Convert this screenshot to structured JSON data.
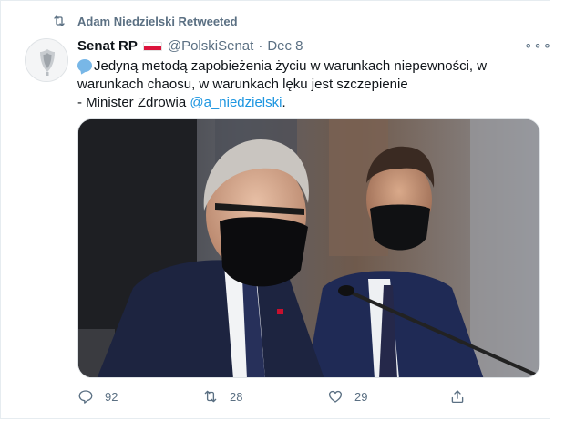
{
  "retweet": {
    "label": "Adam Niedzielski Retweeted"
  },
  "author": {
    "name": "Senat RP",
    "handle": "@PolskiSenat",
    "separator": "·",
    "date": "Dec 8"
  },
  "tweet": {
    "line1": "Jedyną metodą zapobieżenia życiu w warunkach niepewności, w",
    "line2": "warunkach chaosu, w warunkach lęku jest szczepienie",
    "line3_prefix": "- Minister Zdrowia ",
    "mention": "@a_niedzielski",
    "line3_suffix": "."
  },
  "more_label": "∘∘∘",
  "actions": {
    "replies": "92",
    "retweets": "28",
    "likes": "29"
  },
  "icons": [
    "retweet-icon",
    "avatar-emblem-icon",
    "poland-flag-icon",
    "speech-bubble-icon",
    "more-icon",
    "reply-icon",
    "like-icon",
    "share-icon"
  ],
  "colors": {
    "link": "#1b95e0",
    "muted": "#5b7083",
    "text": "#0f1419",
    "flag_red": "#dc143c"
  }
}
